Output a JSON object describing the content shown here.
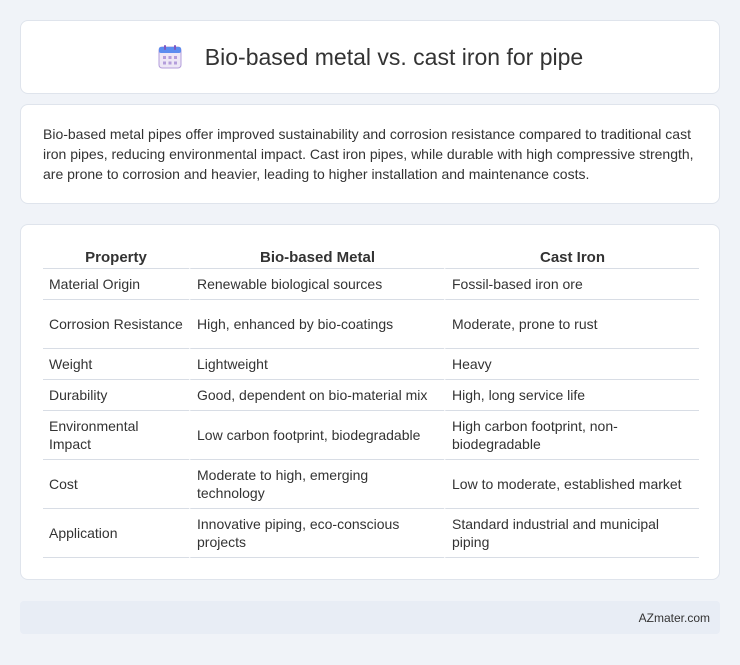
{
  "header": {
    "title": "Bio-based metal vs. cast iron for pipe",
    "icon": "calendar-icon",
    "icon_colors": {
      "top": "#5b8def",
      "grid": "#b39ddb",
      "body": "#ede7f6"
    }
  },
  "summary": {
    "text": "Bio-based metal pipes offer improved sustainability and corrosion resistance compared to traditional cast iron pipes, reducing environmental impact. Cast iron pipes, while durable with high compressive strength, are prone to corrosion and heavier, leading to higher installation and maintenance costs."
  },
  "table": {
    "headers": [
      "Property",
      "Bio-based Metal",
      "Cast Iron"
    ],
    "rows": [
      [
        "Material Origin",
        "Renewable biological sources",
        "Fossil-based iron ore"
      ],
      [
        "Corrosion Resistance",
        "High, enhanced by bio-coatings",
        "Moderate, prone to rust"
      ],
      [
        "Weight",
        "Lightweight",
        "Heavy"
      ],
      [
        "Durability",
        "Good, dependent on bio-material mix",
        "High, long service life"
      ],
      [
        "Environmental Impact",
        "Low carbon footprint, biodegradable",
        "High carbon footprint, non-biodegradable"
      ],
      [
        "Cost",
        "Moderate to high, emerging technology",
        "Low to moderate, established market"
      ],
      [
        "Application",
        "Innovative piping, eco-conscious projects",
        "Standard industrial and municipal piping"
      ]
    ]
  },
  "footer": {
    "text": "AZmater.com"
  }
}
